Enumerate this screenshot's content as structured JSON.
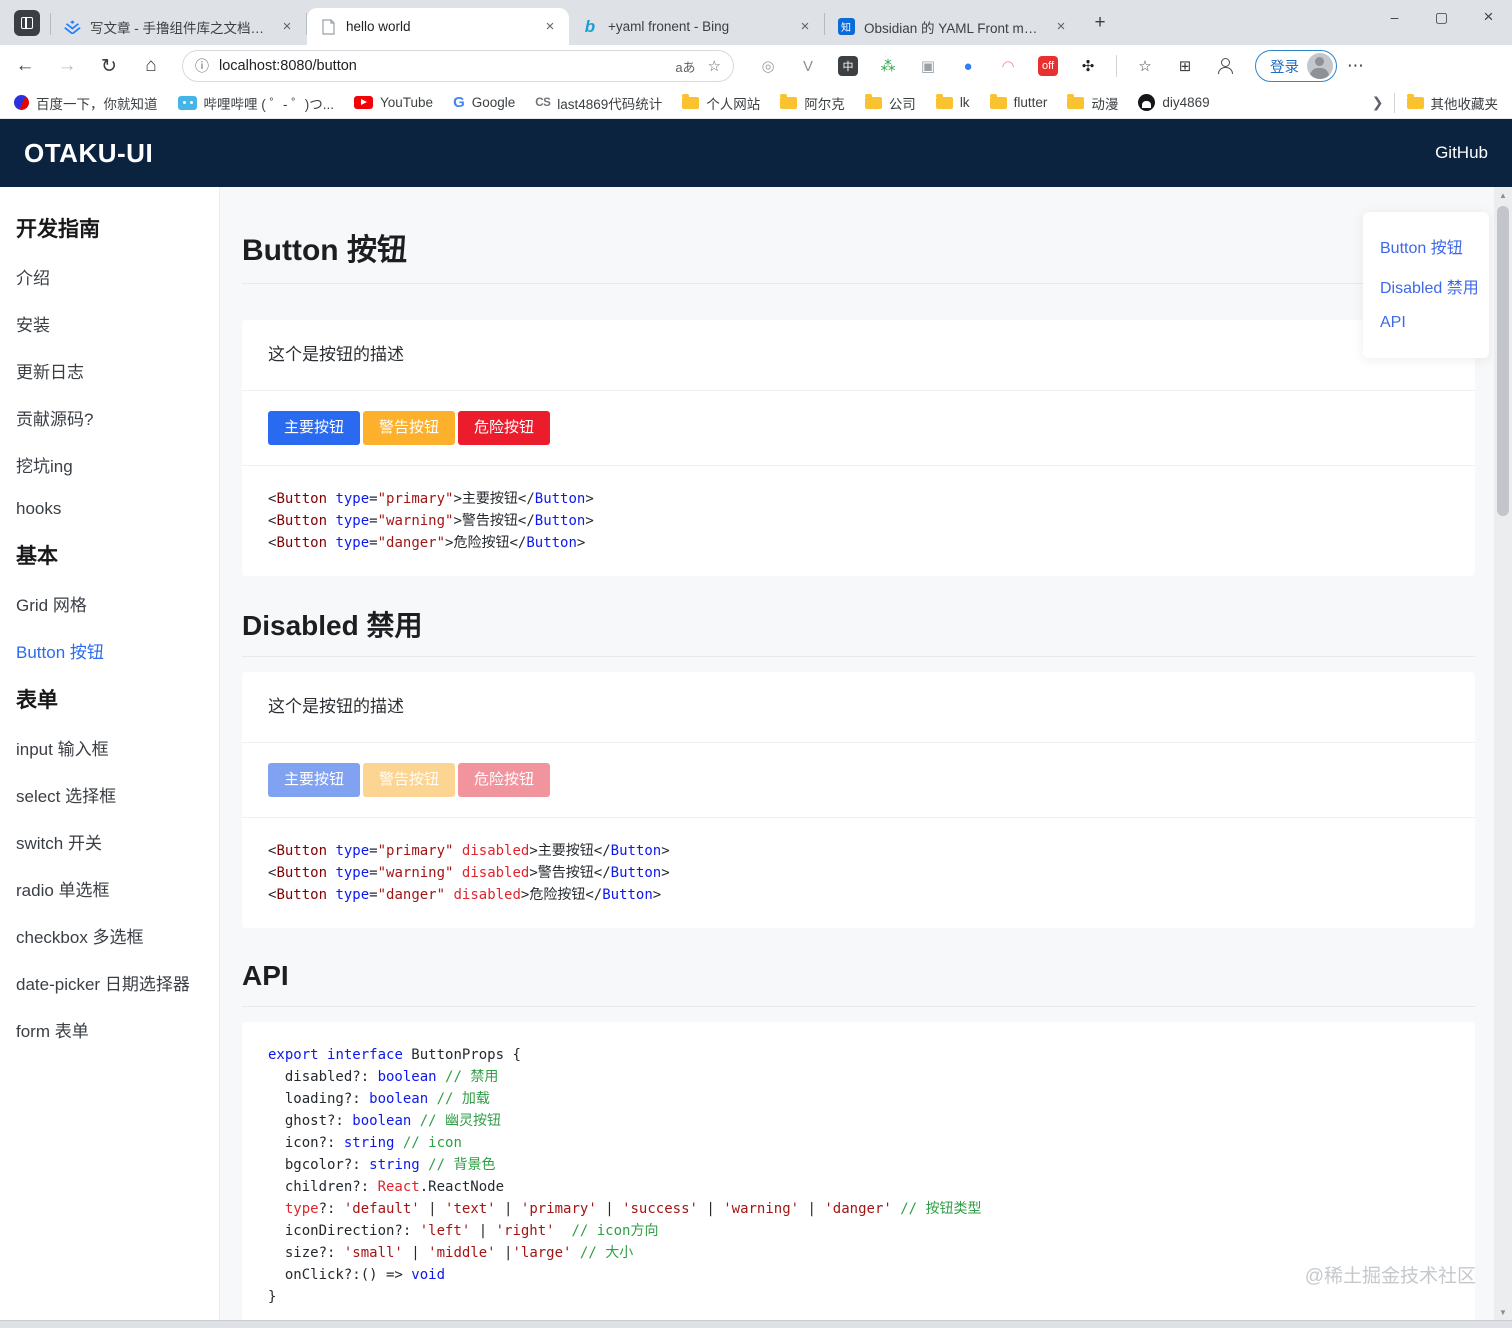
{
  "browser": {
    "tabs": [
      {
        "icon": "juejin",
        "title": "写文章 - 手撸组件库之文档工具",
        "active": false
      },
      {
        "icon": "page",
        "title": "hello world",
        "active": true
      },
      {
        "icon": "bing",
        "title": "+yaml fronent - Bing",
        "active": false
      },
      {
        "icon": "zhihu",
        "title": "Obsidian 的 YAML Front matter",
        "active": false
      }
    ],
    "new_tab_glyph": "+",
    "window_controls": {
      "minimize": "–",
      "maximize": "▢",
      "close": "×"
    },
    "url": "localhost:8080/button",
    "translate_label": "aあ",
    "login_label": "登录",
    "extensions": [
      {
        "name": "extension-atom",
        "glyph": "◎",
        "color": "#9aa0a6",
        "bg": ""
      },
      {
        "name": "extension-vue",
        "glyph": "V",
        "color": "#8a9097",
        "bg": ""
      },
      {
        "name": "extension-translate",
        "glyph": "中",
        "color": "#ffffff",
        "bg": "#3c4043"
      },
      {
        "name": "extension-baidu-paw",
        "glyph": "⁂",
        "color": "#2bab4a",
        "bg": ""
      },
      {
        "name": "extension-box",
        "glyph": "▣",
        "color": "#9aa0a6",
        "bg": ""
      },
      {
        "name": "extension-blue-dot",
        "glyph": "●",
        "color": "#2f7ef3",
        "bg": ""
      },
      {
        "name": "extension-cat",
        "glyph": "◠",
        "color": "#f08ca0",
        "bg": ""
      },
      {
        "name": "extension-off-badge",
        "glyph": "off",
        "color": "#ffffff",
        "bg": "#e83030"
      },
      {
        "name": "extension-clover",
        "glyph": "✣",
        "color": "#202124",
        "bg": ""
      }
    ],
    "bookmarks": [
      {
        "icon": "baidu",
        "label": "百度一下，你就知道"
      },
      {
        "icon": "bilibili",
        "label": "哔哩哔哩 ( ゜- ゜)つ..."
      },
      {
        "icon": "youtube",
        "label": "YouTube"
      },
      {
        "icon": "google",
        "label": "Google"
      },
      {
        "icon": "cs",
        "label": "last4869代码统计"
      },
      {
        "icon": "folder",
        "label": "个人网站"
      },
      {
        "icon": "folder",
        "label": "阿尔克"
      },
      {
        "icon": "folder",
        "label": "公司"
      },
      {
        "icon": "folder",
        "label": "lk"
      },
      {
        "icon": "folder",
        "label": "flutter"
      },
      {
        "icon": "folder",
        "label": "动漫"
      },
      {
        "icon": "github",
        "label": "diy4869"
      }
    ],
    "more_bookmarks_label": "其他收藏夹"
  },
  "navbar": {
    "brand": "OTAKU-UI",
    "github": "GitHub"
  },
  "sidebar": {
    "groups": [
      {
        "title": "开发指南",
        "items": [
          {
            "label": "介绍"
          },
          {
            "label": "安装"
          },
          {
            "label": "更新日志"
          },
          {
            "label": "贡献源码?"
          },
          {
            "label": "挖坑ing"
          },
          {
            "label": "hooks"
          }
        ]
      },
      {
        "title": "基本",
        "items": [
          {
            "label": "Grid 网格"
          },
          {
            "label": "Button 按钮",
            "active": true
          }
        ]
      },
      {
        "title": "表单",
        "items": [
          {
            "label": "input 输入框"
          },
          {
            "label": "select 选择框"
          },
          {
            "label": "switch 开关"
          },
          {
            "label": "radio 单选框"
          },
          {
            "label": "checkbox 多选框"
          },
          {
            "label": "date-picker 日期选择器"
          },
          {
            "label": "form 表单"
          }
        ]
      }
    ]
  },
  "content": {
    "sections": [
      {
        "id": "button",
        "heading": "Button 按钮",
        "desc": "这个是按钮的描述",
        "buttons": [
          {
            "label": "主要按钮",
            "style": "primary",
            "disabled": false
          },
          {
            "label": "警告按钮",
            "style": "warning",
            "disabled": false
          },
          {
            "label": "危险按钮",
            "style": "danger",
            "disabled": false
          }
        ],
        "code": [
          [
            [
              "d",
              "<"
            ],
            [
              "t",
              "Button"
            ],
            [
              "d",
              " "
            ],
            [
              "a",
              "type"
            ],
            [
              "d",
              "="
            ],
            [
              "s",
              "\"primary\""
            ],
            [
              "d",
              ">"
            ],
            [
              "d",
              "主要按钮"
            ],
            [
              "d",
              "</"
            ],
            [
              "a",
              "Button"
            ],
            [
              "d",
              ">"
            ]
          ],
          [
            [
              "d",
              "<"
            ],
            [
              "t",
              "Button"
            ],
            [
              "d",
              " "
            ],
            [
              "a",
              "type"
            ],
            [
              "d",
              "="
            ],
            [
              "s",
              "\"warning\""
            ],
            [
              "d",
              ">"
            ],
            [
              "d",
              "警告按钮"
            ],
            [
              "d",
              "</"
            ],
            [
              "a",
              "Button"
            ],
            [
              "d",
              ">"
            ]
          ],
          [
            [
              "d",
              "<"
            ],
            [
              "t",
              "Button"
            ],
            [
              "d",
              " "
            ],
            [
              "a",
              "type"
            ],
            [
              "d",
              "="
            ],
            [
              "s",
              "\"danger\""
            ],
            [
              "d",
              ">"
            ],
            [
              "d",
              "危险按钮"
            ],
            [
              "d",
              "</"
            ],
            [
              "a",
              "Button"
            ],
            [
              "d",
              ">"
            ]
          ]
        ]
      },
      {
        "id": "disabled",
        "heading": "Disabled 禁用",
        "desc": "这个是按钮的描述",
        "buttons": [
          {
            "label": "主要按钮",
            "style": "primary",
            "disabled": true
          },
          {
            "label": "警告按钮",
            "style": "warning",
            "disabled": true
          },
          {
            "label": "危险按钮",
            "style": "danger",
            "disabled": true
          }
        ],
        "code": [
          [
            [
              "d",
              "<"
            ],
            [
              "t",
              "Button"
            ],
            [
              "d",
              " "
            ],
            [
              "a",
              "type"
            ],
            [
              "d",
              "="
            ],
            [
              "s",
              "\"primary\""
            ],
            [
              "d",
              " "
            ],
            [
              "r",
              "disabled"
            ],
            [
              "d",
              ">"
            ],
            [
              "d",
              "主要按钮"
            ],
            [
              "d",
              "</"
            ],
            [
              "a",
              "Button"
            ],
            [
              "d",
              ">"
            ]
          ],
          [
            [
              "d",
              "<"
            ],
            [
              "t",
              "Button"
            ],
            [
              "d",
              " "
            ],
            [
              "a",
              "type"
            ],
            [
              "d",
              "="
            ],
            [
              "s",
              "\"warning\""
            ],
            [
              "d",
              " "
            ],
            [
              "r",
              "disabled"
            ],
            [
              "d",
              ">"
            ],
            [
              "d",
              "警告按钮"
            ],
            [
              "d",
              "</"
            ],
            [
              "a",
              "Button"
            ],
            [
              "d",
              ">"
            ]
          ],
          [
            [
              "d",
              "<"
            ],
            [
              "t",
              "Button"
            ],
            [
              "d",
              " "
            ],
            [
              "a",
              "type"
            ],
            [
              "d",
              "="
            ],
            [
              "s",
              "\"danger\""
            ],
            [
              "d",
              " "
            ],
            [
              "r",
              "disabled"
            ],
            [
              "d",
              ">"
            ],
            [
              "d",
              "危险按钮"
            ],
            [
              "d",
              "</"
            ],
            [
              "a",
              "Button"
            ],
            [
              "d",
              ">"
            ]
          ]
        ]
      },
      {
        "id": "api",
        "heading": "API",
        "code": [
          [
            [
              "a",
              "export"
            ],
            [
              "d",
              " "
            ],
            [
              "a",
              "interface"
            ],
            [
              "d",
              " ButtonProps {"
            ]
          ],
          [
            [
              "d",
              "  disabled?: "
            ],
            [
              "a",
              "boolean"
            ],
            [
              "d",
              " "
            ],
            [
              "g",
              "// 禁用"
            ]
          ],
          [
            [
              "d",
              "  loading?: "
            ],
            [
              "a",
              "boolean"
            ],
            [
              "d",
              " "
            ],
            [
              "g",
              "// 加载"
            ]
          ],
          [
            [
              "d",
              "  ghost?: "
            ],
            [
              "a",
              "boolean"
            ],
            [
              "d",
              " "
            ],
            [
              "g",
              "// 幽灵按钮"
            ]
          ],
          [
            [
              "d",
              "  icon?: "
            ],
            [
              "a",
              "string"
            ],
            [
              "d",
              " "
            ],
            [
              "g",
              "// icon"
            ]
          ],
          [
            [
              "d",
              "  bgcolor?: "
            ],
            [
              "a",
              "string"
            ],
            [
              "d",
              " "
            ],
            [
              "g",
              "// 背景色"
            ]
          ],
          [
            [
              "d",
              "  children?: "
            ],
            [
              "r",
              "React"
            ],
            [
              "d",
              ".ReactNode"
            ]
          ],
          [
            [
              "r",
              "  type"
            ],
            [
              "d",
              "?: "
            ],
            [
              "s",
              "'default'"
            ],
            [
              "d",
              " | "
            ],
            [
              "s",
              "'text'"
            ],
            [
              "d",
              " | "
            ],
            [
              "s",
              "'primary'"
            ],
            [
              "d",
              " | "
            ],
            [
              "s",
              "'success'"
            ],
            [
              "d",
              " | "
            ],
            [
              "s",
              "'warning'"
            ],
            [
              "d",
              " | "
            ],
            [
              "s",
              "'danger'"
            ],
            [
              "d",
              " "
            ],
            [
              "g",
              "// 按钮类型"
            ]
          ],
          [
            [
              "d",
              "  iconDirection?: "
            ],
            [
              "s",
              "'left'"
            ],
            [
              "d",
              " | "
            ],
            [
              "s",
              "'right'"
            ],
            [
              "d",
              "  "
            ],
            [
              "g",
              "// icon方向"
            ]
          ],
          [
            [
              "d",
              "  size?: "
            ],
            [
              "s",
              "'small'"
            ],
            [
              "d",
              " | "
            ],
            [
              "s",
              "'middle'"
            ],
            [
              "d",
              " |"
            ],
            [
              "s",
              "'large'"
            ],
            [
              "d",
              " "
            ],
            [
              "g",
              "// 大小"
            ]
          ],
          [
            [
              "d",
              "  onClick?:() => "
            ],
            [
              "a",
              "void"
            ]
          ],
          [
            [
              "d",
              "}"
            ]
          ]
        ]
      }
    ]
  },
  "toc": {
    "items": [
      "Button 按钮",
      "Disabled 禁用",
      "API"
    ]
  },
  "watermark": "@稀土掘金技术社区",
  "colors": {
    "navbar_bg": "#0c2340",
    "primary": "#2a6af0",
    "warning": "#fcb02c",
    "danger": "#eb1c2c",
    "active_link": "#2b6bf0",
    "page_bg": "#f7f8fa"
  }
}
